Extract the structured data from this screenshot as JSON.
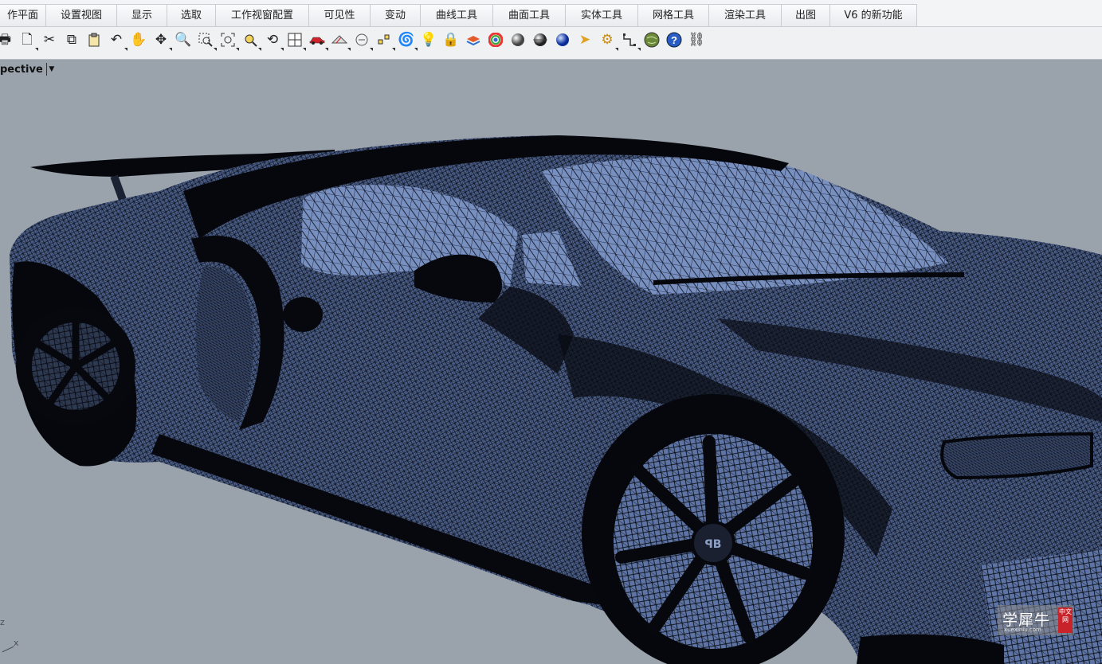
{
  "tabs": [
    {
      "label": "作平面"
    },
    {
      "label": "设置视图"
    },
    {
      "label": "显示"
    },
    {
      "label": "选取"
    },
    {
      "label": "工作视窗配置"
    },
    {
      "label": "可见性"
    },
    {
      "label": "变动"
    },
    {
      "label": "曲线工具"
    },
    {
      "label": "曲面工具"
    },
    {
      "label": "实体工具"
    },
    {
      "label": "网格工具"
    },
    {
      "label": "渲染工具"
    },
    {
      "label": "出图"
    },
    {
      "label": "V6 的新功能"
    }
  ],
  "toolbar": {
    "tools": [
      {
        "icon": "print-icon"
      },
      {
        "icon": "page-setup-icon"
      },
      {
        "icon": "cut-icon"
      },
      {
        "icon": "copy-icon"
      },
      {
        "icon": "paste-icon"
      },
      {
        "icon": "undo-icon"
      },
      {
        "icon": "pan-hand-icon"
      },
      {
        "icon": "rotate-view-icon"
      },
      {
        "icon": "zoom-dynamic-icon"
      },
      {
        "icon": "zoom-window-icon"
      },
      {
        "icon": "zoom-extents-icon"
      },
      {
        "icon": "zoom-selected-icon"
      },
      {
        "icon": "undo-view-icon"
      },
      {
        "icon": "four-viewports-icon"
      },
      {
        "icon": "car-icon"
      },
      {
        "icon": "grid-snap-icon"
      },
      {
        "icon": "cplane-icon"
      },
      {
        "icon": "select-points-icon"
      },
      {
        "icon": "spiral-icon"
      },
      {
        "icon": "light-bulb-icon"
      },
      {
        "icon": "lock-icon"
      },
      {
        "icon": "layer-icon"
      },
      {
        "icon": "color-wheel-icon"
      },
      {
        "icon": "shade-icon"
      },
      {
        "icon": "rendered-sphere-icon"
      },
      {
        "icon": "render-icon"
      },
      {
        "icon": "pointer-options-icon"
      },
      {
        "icon": "gear-icon"
      },
      {
        "icon": "dimension-icon"
      },
      {
        "icon": "globe-icon"
      },
      {
        "icon": "help-icon"
      },
      {
        "icon": "link-icon"
      }
    ]
  },
  "viewport": {
    "title": "pective",
    "axis_z": "z",
    "axis_x": "x"
  },
  "watermark": {
    "text": "学犀牛",
    "sub": "xuexiniu.com",
    "stamp": "中文网"
  },
  "colors": {
    "viewport_bg": "#9aa2ac",
    "mesh_fill": "#4a5e88",
    "mesh_light": "#7f97c4",
    "wire": "#080a10"
  }
}
